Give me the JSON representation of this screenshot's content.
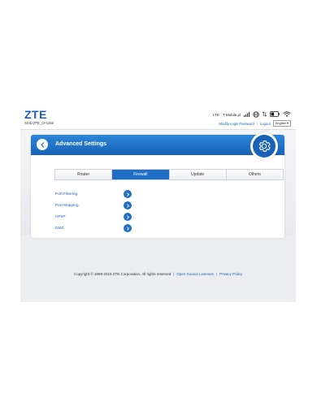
{
  "header": {
    "logo": "ZTE",
    "ssid": "SSID:ZTE_CF1260",
    "network_type": "LTE",
    "operator": "T-Mobile.pl",
    "modify_password": "Modify Login Password",
    "separator": "|",
    "logout": "Logout",
    "language": "English",
    "icons": [
      "signal-icon",
      "globe-icon",
      "data-transfer-icon",
      "battery-icon",
      "wifi-icon"
    ]
  },
  "card": {
    "title": "Advanced Settings",
    "tabs": [
      {
        "label": "Router",
        "active": false
      },
      {
        "label": "Firewall",
        "active": true
      },
      {
        "label": "Update",
        "active": false
      },
      {
        "label": "Others",
        "active": false
      }
    ],
    "menu": [
      {
        "label": "Port Filtering"
      },
      {
        "label": "Port Mapping"
      },
      {
        "label": "UPnP"
      },
      {
        "label": "DMZ"
      }
    ]
  },
  "footer": {
    "copyright": "Copyright © 1998-2019 ZTE Corporation. All rights reserved",
    "sep": "|",
    "open_source": "Open Source Licenses",
    "privacy": "Privacy Policy"
  },
  "colors": {
    "brand_blue": "#1d5fb6",
    "header_blue": "#1762b8",
    "active_tab": "#1f6fc6",
    "page_bg": "#ebedf1"
  }
}
